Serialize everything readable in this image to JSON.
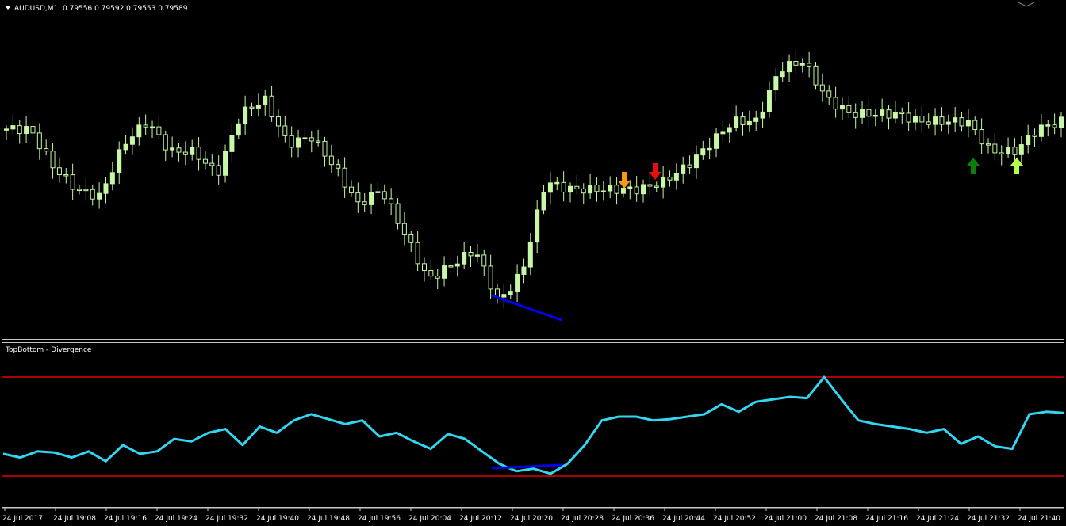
{
  "header": {
    "symbol": "AUDUSD,M1",
    "quote": "0.79556 0.79592 0.79553 0.79589"
  },
  "indicator": {
    "title": "TopBottom - Divergence"
  },
  "colors": {
    "background": "#000000",
    "frame": "#c8c8c8",
    "candle": "#c8f7a8",
    "divergence_line": "#0000ee",
    "oscillator": "#33d6f0",
    "level_line": "#e60000",
    "arrow_orange": "#f59a12",
    "arrow_red": "#e61010",
    "arrow_darkgreen": "#0a7d0a",
    "arrow_lightgreen": "#b6ff4a",
    "text": "#ffffff"
  },
  "chart_data": {
    "type": "candlestick",
    "symbol": "AUDUSD",
    "timeframe": "M1",
    "x_ticks": [
      "24 Jul 2017",
      "24 Jul 19:08",
      "24 Jul 19:16",
      "24 Jul 19:24",
      "24 Jul 19:32",
      "24 Jul 19:40",
      "24 Jul 19:48",
      "24 Jul 19:56",
      "24 Jul 20:04",
      "24 Jul 20:12",
      "24 Jul 20:20",
      "24 Jul 20:28",
      "24 Jul 20:36",
      "24 Jul 20:44",
      "24 Jul 20:52",
      "24 Jul 21:00",
      "24 Jul 21:08",
      "24 Jul 21:16",
      "24 Jul 21:24",
      "24 Jul 21:32",
      "24 Jul 21:40"
    ],
    "price_close_profile": [
      0.7957,
      0.7957,
      0.7952,
      0.7949,
      0.7948,
      0.7955,
      0.7958,
      0.7954,
      0.7954,
      0.7951,
      0.7959,
      0.7961,
      0.7955,
      0.7956,
      0.7952,
      0.7947,
      0.7949,
      0.7943,
      0.7937,
      0.7939,
      0.7941,
      0.7934,
      0.7938,
      0.795,
      0.7949,
      0.7949,
      0.7949,
      0.7949,
      0.795,
      0.7952,
      0.7955,
      0.7958,
      0.7958,
      0.7965,
      0.7966,
      0.7961,
      0.7959,
      0.7959,
      0.7959,
      0.7958,
      0.7958,
      0.7958,
      0.7954,
      0.7954,
      0.7957,
      0.7958
    ],
    "oscillator": {
      "name": "TopBottom - Divergence",
      "upper_level": 0.9,
      "lower_level": 0.1,
      "values": [
        0.28,
        0.25,
        0.3,
        0.29,
        0.25,
        0.3,
        0.22,
        0.35,
        0.28,
        0.3,
        0.4,
        0.38,
        0.45,
        0.48,
        0.35,
        0.5,
        0.45,
        0.55,
        0.6,
        0.56,
        0.52,
        0.55,
        0.42,
        0.45,
        0.38,
        0.32,
        0.44,
        0.4,
        0.3,
        0.2,
        0.14,
        0.16,
        0.12,
        0.2,
        0.35,
        0.55,
        0.58,
        0.58,
        0.55,
        0.56,
        0.58,
        0.6,
        0.68,
        0.62,
        0.7,
        0.72,
        0.74,
        0.73,
        0.9,
        0.72,
        0.55,
        0.52,
        0.5,
        0.48,
        0.45,
        0.48,
        0.36,
        0.42,
        0.34,
        0.32,
        0.6,
        0.62,
        0.61
      ]
    },
    "signals": [
      {
        "direction": "down",
        "color": "orange",
        "time": "24 Jul 20:35"
      },
      {
        "direction": "down",
        "color": "red",
        "time": "24 Jul 20:38"
      },
      {
        "direction": "up",
        "color": "darkgreen",
        "time": "24 Jul 21:28"
      },
      {
        "direction": "up",
        "color": "lightgreen",
        "time": "24 Jul 21:32"
      }
    ],
    "divergence": {
      "from": "24 Jul 20:13",
      "to": "24 Jul 20:26"
    },
    "grid": false
  }
}
